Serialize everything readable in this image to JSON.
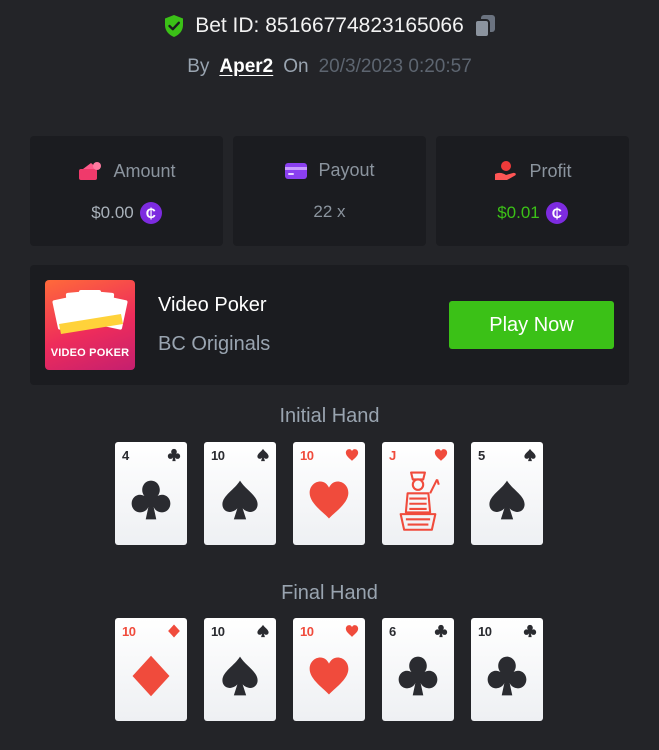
{
  "header": {
    "bet_id_text": "Bet ID: 85166774823165066",
    "by_label": "By",
    "username": "Aper2",
    "on_label": "On",
    "date": "20/3/2023 0:20:57"
  },
  "stats": [
    {
      "title": "Amount",
      "value": "$0.00",
      "icon": "amount-icon",
      "coin": true,
      "value_color": "#a9b1ba"
    },
    {
      "title": "Payout",
      "value": "22 x",
      "icon": "payout-icon",
      "coin": false,
      "value_color": "#8b949e"
    },
    {
      "title": "Profit",
      "value": "$0.01",
      "icon": "profit-icon",
      "coin": true,
      "value_color": "#3bc117"
    }
  ],
  "coin_symbol": "₵",
  "game": {
    "thumbnail_label": "VIDEO POKER",
    "name": "Video Poker",
    "provider": "BC Originals",
    "play_button": "Play Now"
  },
  "initial_hand": {
    "title": "Initial Hand",
    "cards": [
      {
        "rank": "4",
        "suit": "clubs"
      },
      {
        "rank": "10",
        "suit": "spades"
      },
      {
        "rank": "10",
        "suit": "hearts"
      },
      {
        "rank": "J",
        "suit": "hearts"
      },
      {
        "rank": "5",
        "suit": "spades"
      }
    ]
  },
  "final_hand": {
    "title": "Final Hand",
    "cards": [
      {
        "rank": "10",
        "suit": "diamonds"
      },
      {
        "rank": "10",
        "suit": "spades"
      },
      {
        "rank": "10",
        "suit": "hearts"
      },
      {
        "rank": "6",
        "suit": "clubs"
      },
      {
        "rank": "10",
        "suit": "clubs"
      }
    ]
  },
  "colors": {
    "background": "#232428",
    "panel": "#1b1c20",
    "accent_green": "#3bc117",
    "coin_purple": "#7d2be0",
    "card_red": "#f04b3c"
  }
}
